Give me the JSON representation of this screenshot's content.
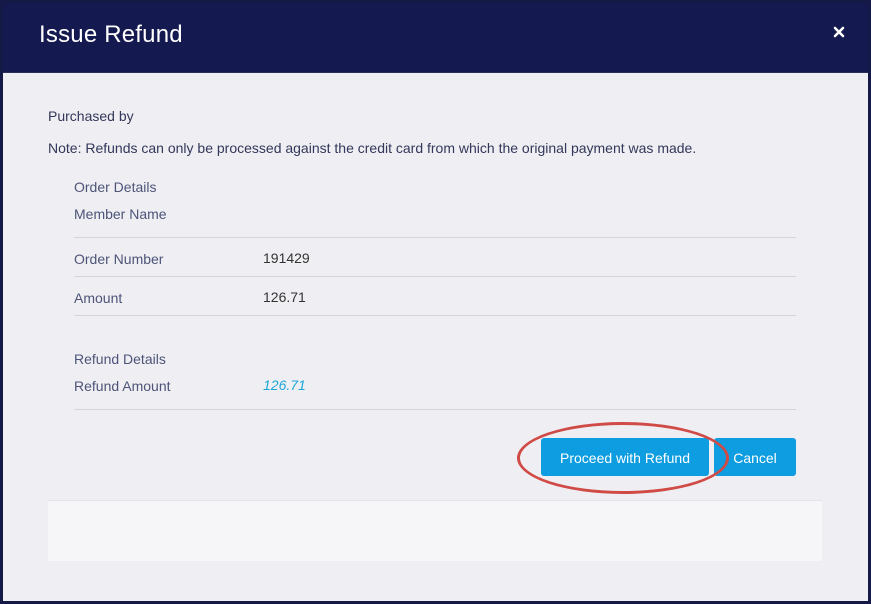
{
  "dialog": {
    "title": "Issue Refund",
    "close_icon": "close-icon"
  },
  "body": {
    "purchased_by": "Purchased by",
    "note": "Note: Refunds can only be processed against the credit card from which the original payment was made."
  },
  "order_details": {
    "heading": "Order Details",
    "member_name_label": "Member Name",
    "member_name_value": "",
    "order_number_label": "Order Number",
    "order_number_value": "191429",
    "amount_label": "Amount",
    "amount_value": "126.71"
  },
  "refund_details": {
    "heading": "Refund Details",
    "refund_amount_label": "Refund Amount",
    "refund_amount_value": "126.71"
  },
  "actions": {
    "proceed_label": "Proceed with Refund",
    "cancel_label": "Cancel"
  },
  "colors": {
    "header_bg": "#141a4f",
    "button_bg": "#0d9de0",
    "annotation": "#d04a46"
  }
}
